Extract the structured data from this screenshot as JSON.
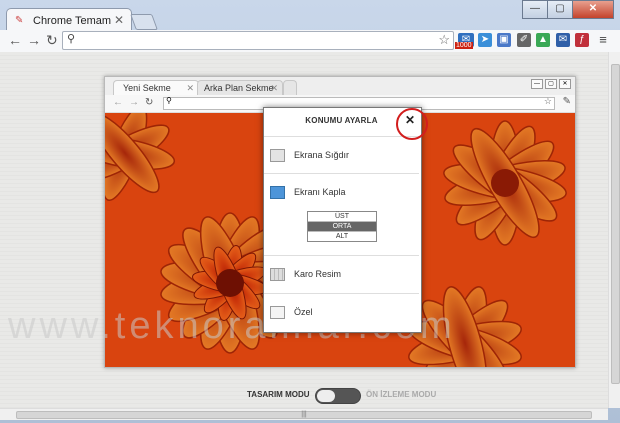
{
  "browser": {
    "tab_title": "Chrome Temam",
    "close_glyph": "✕",
    "window_buttons": [
      "—",
      "▢",
      "✕"
    ]
  },
  "extensions": {
    "badge_count": "1000"
  },
  "preview": {
    "tabs": [
      {
        "label": "Yeni Sekme"
      },
      {
        "label": "Arka Plan Sekme"
      }
    ]
  },
  "dialog": {
    "title": "KONUMU AYARLA",
    "close": "✕",
    "options": [
      {
        "label": "Ekrana Sığdır"
      },
      {
        "label": "Ekranı Kapla"
      },
      {
        "label": "Karo Resim"
      },
      {
        "label": "Özel"
      }
    ],
    "positions": [
      "ÜST",
      "ORTA",
      "ALT"
    ],
    "selected_position": "ORTA"
  },
  "watermark": "www.teknoramlar.com",
  "modes": {
    "left": "TASARIM MODU",
    "right": "ÖN İZLEME MODU"
  },
  "colors": {
    "accent_blue": "#4d95d9",
    "highlight_ring": "#d21e1e",
    "flower": "#d8400c"
  }
}
